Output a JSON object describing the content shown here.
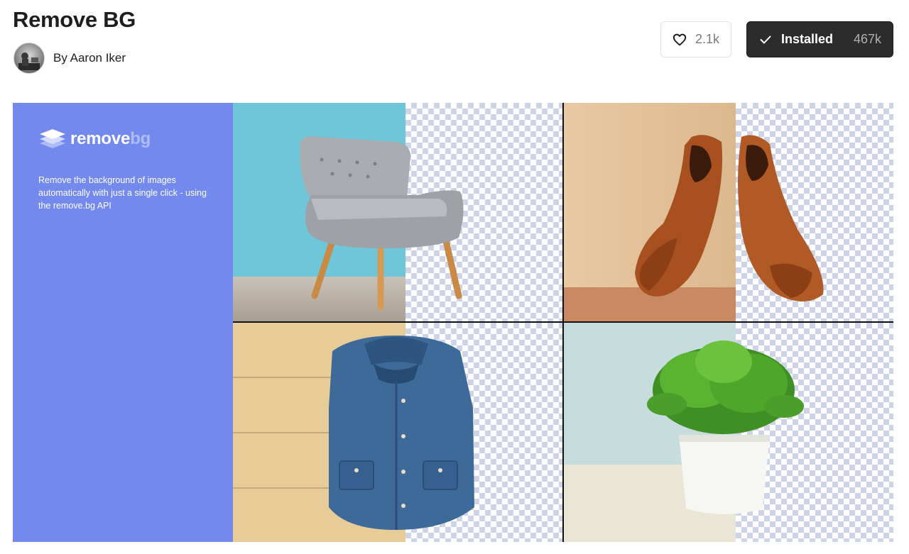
{
  "title": "Remove BG",
  "author": {
    "label": "By Aaron Iker"
  },
  "like_button": {
    "count": "2.1k"
  },
  "installed_button": {
    "label": "Installed",
    "count": "467k"
  },
  "banner": {
    "brand_name_part1": "remove",
    "brand_name_part2": "bg",
    "description": "Remove the background of images automatically with just a single click - using the remove.bg API",
    "brand_color": "#7389ee",
    "tiles": [
      "chair",
      "shoes",
      "denim-shirt",
      "potted-plant"
    ]
  },
  "colors": {
    "installed_bg": "#2c2c2c",
    "accent_panel": "#7389ee"
  }
}
